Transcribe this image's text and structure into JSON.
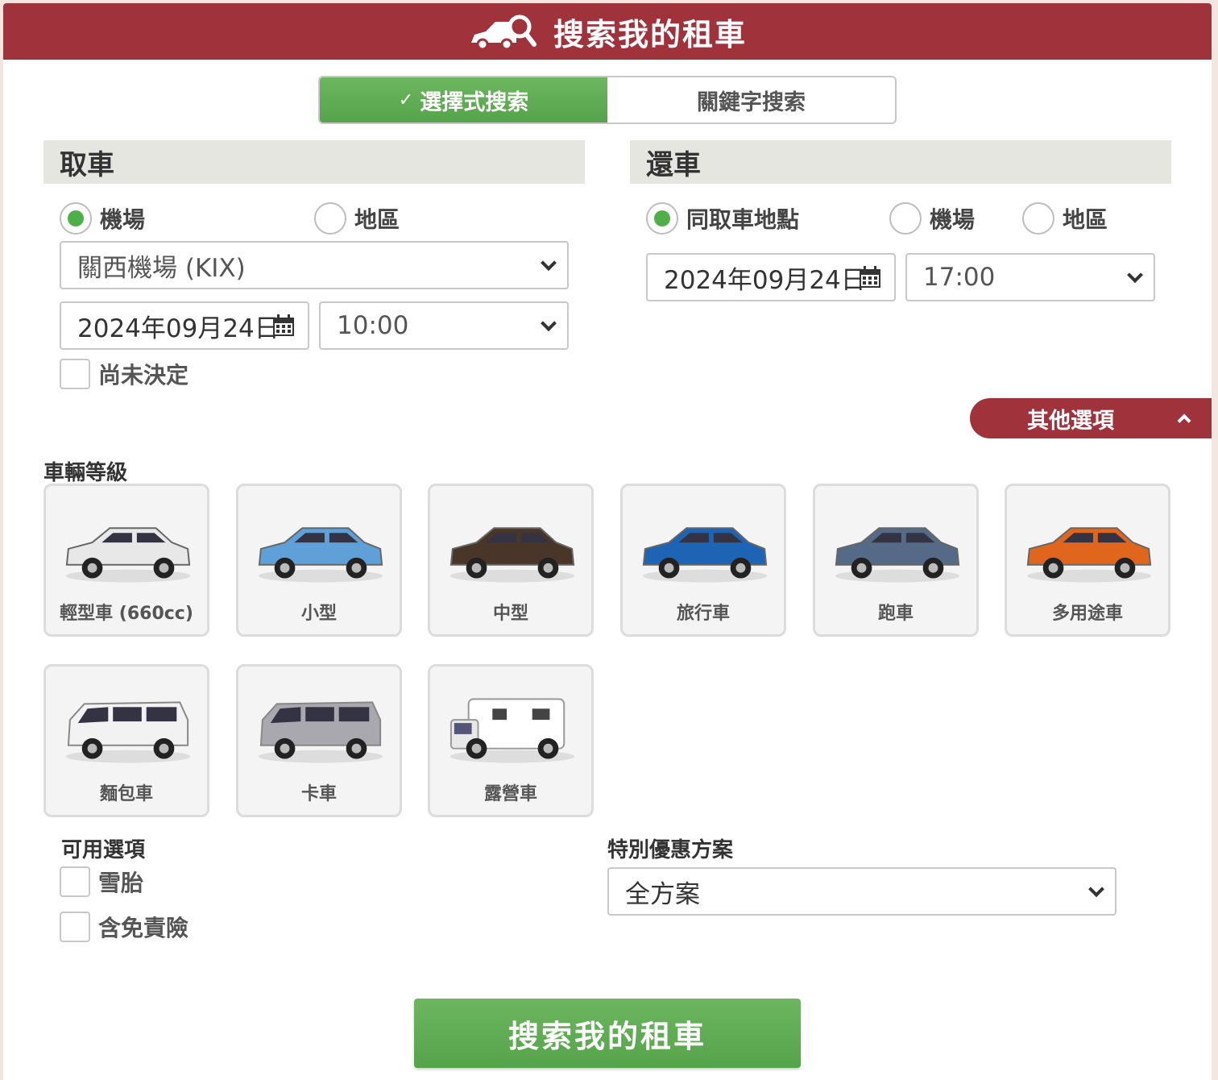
{
  "header": {
    "title": "搜索我的租車"
  },
  "tabs": [
    {
      "label": "選擇式搜索",
      "active": true
    },
    {
      "label": "關鍵字搜索",
      "active": false
    }
  ],
  "pickup": {
    "heading": "取車",
    "radios": [
      {
        "label": "機場",
        "checked": true
      },
      {
        "label": "地區",
        "checked": false
      }
    ],
    "location": "關西機場 (KIX)",
    "date": "2024年09月24日",
    "time": "10:00",
    "undecided_label": "尚未決定"
  },
  "dropoff": {
    "heading": "還車",
    "radios": [
      {
        "label": "同取車地點",
        "checked": true
      },
      {
        "label": "機場",
        "checked": false
      },
      {
        "label": "地區",
        "checked": false
      }
    ],
    "date": "2024年09月24日",
    "time": "17:00"
  },
  "other_options_label": "其他選項",
  "vehicle_class": {
    "heading": "車輛等級",
    "items": [
      {
        "label": "輕型車 (660cc)",
        "color": "#e8e8e8"
      },
      {
        "label": "小型",
        "color": "#5fa0d8"
      },
      {
        "label": "中型",
        "color": "#4a3628"
      },
      {
        "label": "旅行車",
        "color": "#1e64b4"
      },
      {
        "label": "跑車",
        "color": "#556a86"
      },
      {
        "label": "多用途車",
        "color": "#e0661e"
      },
      {
        "label": "麵包車",
        "color": "#f2f2f2"
      },
      {
        "label": "卡車",
        "color": "#a8a8ae"
      },
      {
        "label": "露營車",
        "color": "#ffffff"
      }
    ]
  },
  "available_options": {
    "heading": "可用選項",
    "items": [
      {
        "label": "雪胎"
      },
      {
        "label": "含免責險"
      }
    ]
  },
  "special_plan": {
    "heading": "特別優惠方案",
    "value": "全方案"
  },
  "search_button_label": "搜索我的租車",
  "colors": {
    "brand": "#a0323c",
    "accent_green": "#55a34a"
  }
}
